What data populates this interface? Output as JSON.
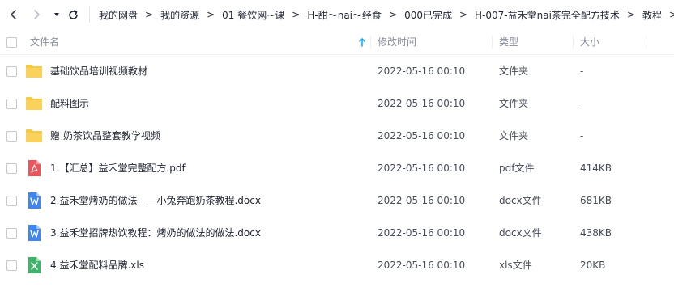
{
  "nav": {
    "back_icon": "chevron-left-icon",
    "forward_icon": "chevron-right-icon",
    "history_icon": "caret-down-icon",
    "refresh_icon": "refresh-icon"
  },
  "breadcrumb": {
    "items": [
      "我的网盘",
      "我的资源",
      "01 餐饮网~课",
      "H-甜～nai～经食",
      "000已完成",
      "H-007-益禾堂nai茶完全配方技术",
      "教程"
    ],
    "separator": ">"
  },
  "columns": {
    "name": "文件名",
    "modified": "修改时间",
    "type": "类型",
    "size": "大小"
  },
  "sort": {
    "column": "name",
    "direction": "ascending",
    "icon": "arrow-up-icon"
  },
  "colors": {
    "folder": "#f7c843",
    "pdf": "#f0535a",
    "word": "#3e86f5",
    "excel": "#3bb566",
    "accent": "#06a7ff"
  },
  "files": [
    {
      "name": "基础饮品培训视频教材",
      "modified": "2022-05-16 00:10",
      "type": "文件夹",
      "size": "-",
      "kind": "folder"
    },
    {
      "name": "配料图示",
      "modified": "2022-05-16 00:10",
      "type": "文件夹",
      "size": "-",
      "kind": "folder"
    },
    {
      "name": "赠 奶茶饮品整套教学视频",
      "modified": "2022-05-16 00:10",
      "type": "文件夹",
      "size": "-",
      "kind": "folder"
    },
    {
      "name": "1.【汇总】益禾堂完整配方.pdf",
      "modified": "2022-05-16 00:10",
      "type": "pdf文件",
      "size": "414KB",
      "kind": "pdf"
    },
    {
      "name": "2.益禾堂烤奶的做法——小兔奔跑奶茶教程.docx",
      "modified": "2022-05-16 00:10",
      "type": "docx文件",
      "size": "681KB",
      "kind": "word"
    },
    {
      "name": "3.益禾堂招牌热饮教程：烤奶的做法的做法.docx",
      "modified": "2022-05-16 00:10",
      "type": "docx文件",
      "size": "438KB",
      "kind": "word"
    },
    {
      "name": "4.益禾堂配料品牌.xls",
      "modified": "2022-05-16 00:10",
      "type": "xls文件",
      "size": "20KB",
      "kind": "excel"
    }
  ]
}
